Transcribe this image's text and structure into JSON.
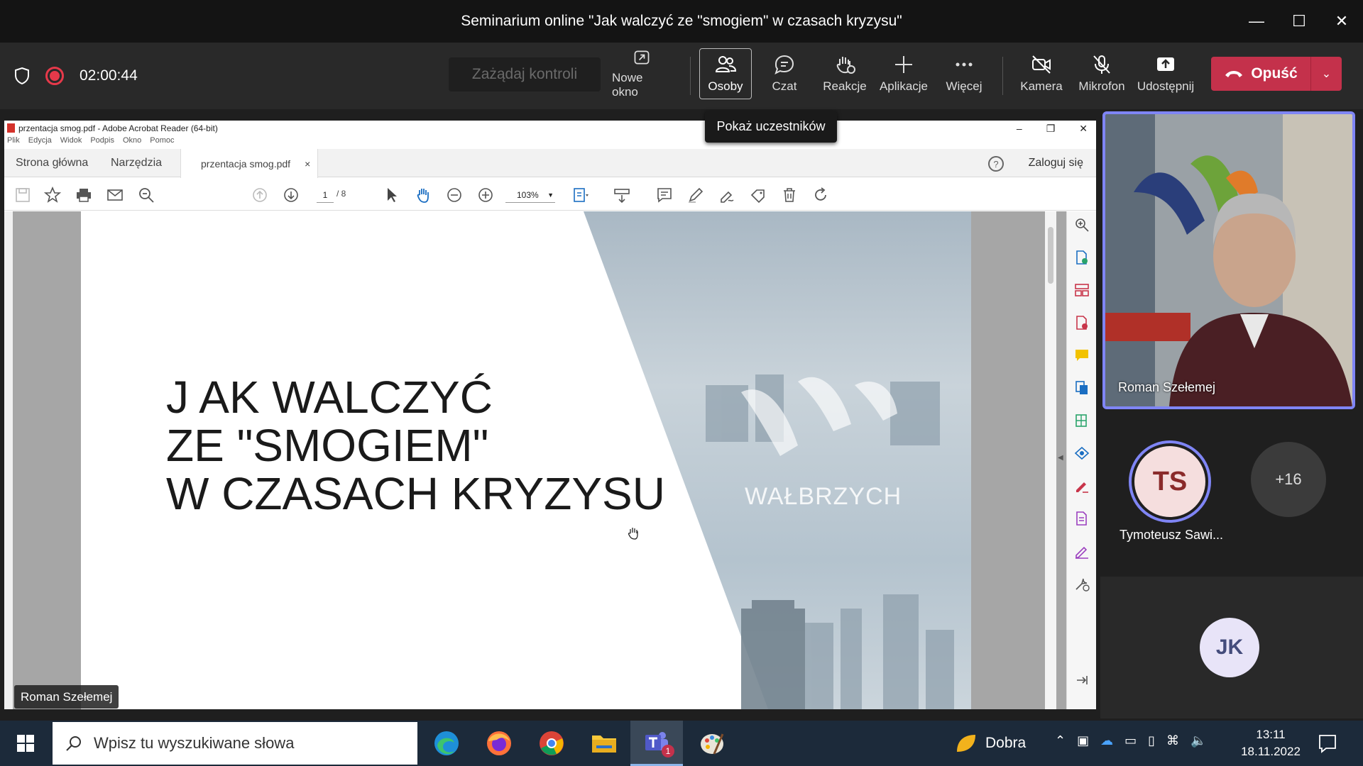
{
  "window": {
    "title": "Seminarium online \"Jak walczyć ze \"smogiem\" w czasach kryzysu\""
  },
  "meeting": {
    "timer": "02:00:44",
    "request_control": "Zażądaj kontroli",
    "buttons": {
      "new_window": "Nowe okno",
      "people": "Osoby",
      "chat": "Czat",
      "reactions": "Reakcje",
      "apps": "Aplikacje",
      "more": "Więcej",
      "camera": "Kamera",
      "mic": "Mikrofon",
      "share": "Udostępnij"
    },
    "leave": "Opuść",
    "tooltip": "Pokaż uczestników"
  },
  "acrobat": {
    "title": "przentacja smog.pdf - Adobe Acrobat Reader (64-bit)",
    "menu": [
      "Plik",
      "Edycja",
      "Widok",
      "Podpis",
      "Okno",
      "Pomoc"
    ],
    "tabs": {
      "home": "Strona główna",
      "tools": "Narzędzia",
      "doc": "przentacja smog.pdf"
    },
    "login": "Zaloguj się",
    "page_current": "1",
    "page_total": "/ 8",
    "zoom": "103%"
  },
  "slide": {
    "title_lines": [
      "J AK WALCZYĆ",
      "ZE \"SMOGIEM\"",
      "W CZASACH KRYZYSU"
    ],
    "brand": "WAŁBRZYCH"
  },
  "presenter_tag": "Roman Szełemej",
  "participants": {
    "video_name": "Roman Szełemej",
    "ts_initials": "TS",
    "ts_name": "Tymoteusz Sawi...",
    "more_count": "+16",
    "jk_initials": "JK"
  },
  "taskbar": {
    "search_placeholder": "Wpisz tu wyszukiwane słowa",
    "weather": "Dobra",
    "time": "13:11",
    "date": "18.11.2022",
    "teams_badge": "1"
  },
  "colors": {
    "accent": "#7f85f5",
    "leave": "#c4314b",
    "record": "#e6394a"
  }
}
